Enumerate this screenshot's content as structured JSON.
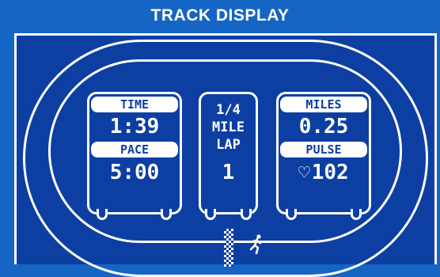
{
  "header": {
    "title": "TRACK DISPLAY"
  },
  "left_panel": {
    "time_label": "TIME",
    "time_value": "1:39",
    "pace_label": "PACE",
    "pace_value": "5:00"
  },
  "middle_panel": {
    "line1": "1/4",
    "line2": "MILE",
    "line3": "LAP",
    "lap_value": "1"
  },
  "right_panel": {
    "miles_label": "MILES",
    "miles_value": "0.25",
    "pulse_label": "PULSE",
    "pulse_value": "102",
    "heart_icon": "heart-icon"
  },
  "colors": {
    "background": "#1565c4",
    "screen": "#0d3fa3",
    "foreground": "#ffffff"
  }
}
